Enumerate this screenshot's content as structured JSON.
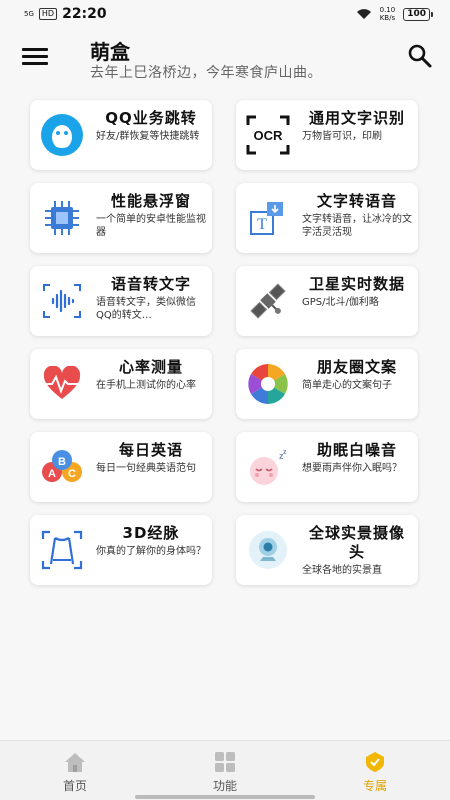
{
  "status_bar": {
    "time": "22:20",
    "network": "5G",
    "badge": "HD",
    "speed_value": "0.10",
    "speed_unit": "KB/s",
    "battery": "100"
  },
  "header": {
    "title": "萌盒",
    "subtitle": "去年上巳洛桥边，今年寒食庐山曲。"
  },
  "cards": [
    {
      "title": "QQ业务跳转",
      "desc": "好友/群恢复等快捷跳转",
      "icon": "qq-penguin-icon"
    },
    {
      "title": "通用文字识别",
      "desc": "万物皆可识，印刷",
      "icon": "ocr-scan-icon",
      "icon_text": "OCR"
    },
    {
      "title": "性能悬浮窗",
      "desc": "一个简单的安卓性能监视器",
      "icon": "cpu-chip-icon"
    },
    {
      "title": "文字转语音",
      "desc": "文字转语音，让冰冷的文字活灵活现",
      "icon": "text-to-speech-icon"
    },
    {
      "title": "语音转文字",
      "desc": "语音转文字，类似微信QQ的转文…",
      "icon": "voice-wave-icon"
    },
    {
      "title": "卫星实时数据",
      "desc": "GPS/北斗/伽利略",
      "icon": "satellite-icon"
    },
    {
      "title": "心率测量",
      "desc": "在手机上测试你的心率",
      "icon": "heart-rate-icon"
    },
    {
      "title": "朋友圈文案",
      "desc": "简单走心的文案句子",
      "icon": "camera-aperture-icon"
    },
    {
      "title": "每日英语",
      "desc": "每日一句经典英语范句",
      "icon": "abc-balloons-icon"
    },
    {
      "title": "助眠白噪音",
      "desc": "想要雨声伴你入眠吗？",
      "icon": "sleeping-face-icon"
    },
    {
      "title": "3D经脉",
      "desc": "你真的了解你的身体吗？",
      "icon": "body-scan-icon"
    },
    {
      "title": "全球实景摄像头",
      "desc": "全球各地的实景直",
      "icon": "webcam-icon"
    }
  ],
  "bottom_nav": [
    {
      "label": "首页",
      "icon": "home-icon"
    },
    {
      "label": "功能",
      "icon": "grid-icon"
    },
    {
      "label": "专属",
      "icon": "badge-icon"
    }
  ],
  "active_nav": "专属",
  "accent_color": "#e0a200"
}
